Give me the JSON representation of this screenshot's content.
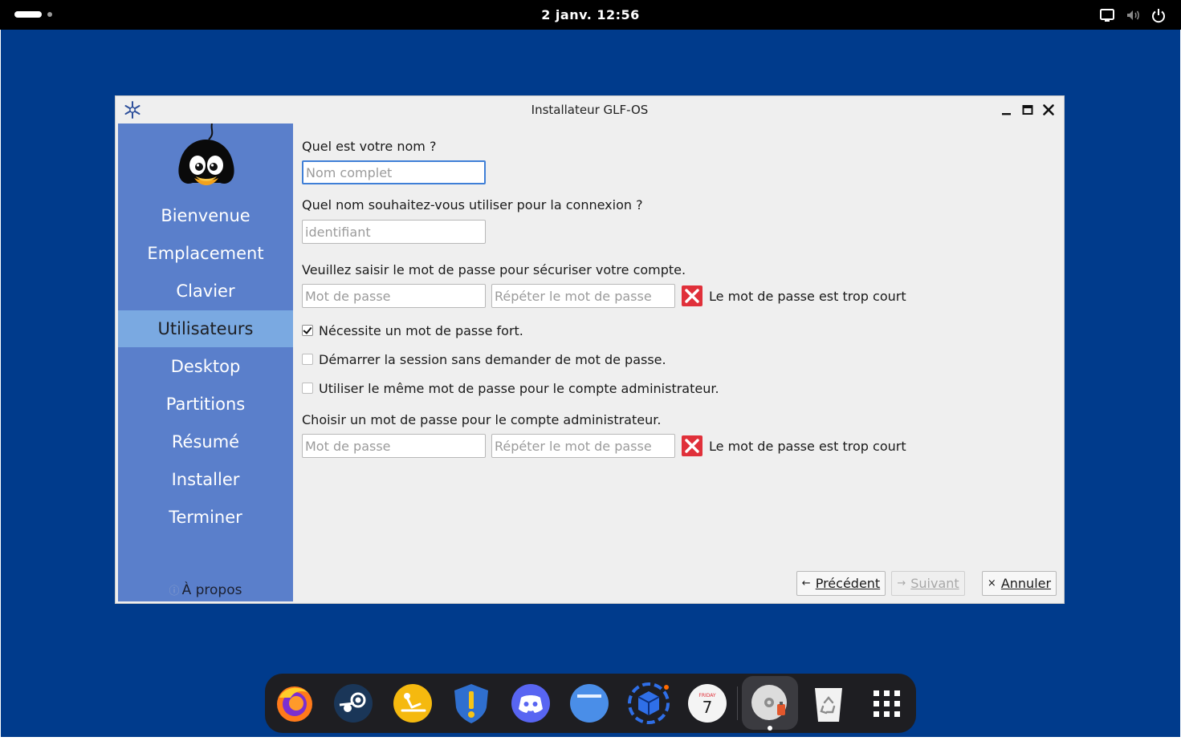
{
  "topbar": {
    "clock": "2 janv. 12:56",
    "icons": [
      "display-icon",
      "volume-muted-icon",
      "power-icon"
    ]
  },
  "window": {
    "title": "Installateur GLF-OS",
    "controls": [
      "minimize-icon",
      "maximize-icon",
      "close-icon"
    ]
  },
  "sidebar": {
    "steps": [
      {
        "label": "Bienvenue",
        "active": false
      },
      {
        "label": "Emplacement",
        "active": false
      },
      {
        "label": "Clavier",
        "active": false
      },
      {
        "label": "Utilisateurs",
        "active": true
      },
      {
        "label": "Desktop",
        "active": false
      },
      {
        "label": "Partitions",
        "active": false
      },
      {
        "label": "Résumé",
        "active": false
      },
      {
        "label": "Installer",
        "active": false
      },
      {
        "label": "Terminer",
        "active": false
      }
    ],
    "about_label": "À propos",
    "accent_color": "#5a7fcb",
    "active_color": "#7aa9e1"
  },
  "form": {
    "name_question": "Quel est votre nom ?",
    "name_placeholder": "Nom complet",
    "login_question": "Quel nom souhaitez-vous utiliser pour la connexion ?",
    "login_placeholder": "identifiant",
    "password_question": "Veuillez saisir le mot de passe pour sécuriser votre compte.",
    "password_placeholder": "Mot de passe",
    "repeat_placeholder": "Répéter le mot de passe",
    "password_error": "Le mot de passe est trop court",
    "checkbox_strong": "Nécessite un mot de passe fort.",
    "checkbox_strong_checked": true,
    "checkbox_autologin": "Démarrer la session sans demander de mot de passe.",
    "checkbox_autologin_checked": false,
    "checkbox_same_admin": "Utiliser le même mot de passe pour le compte administrateur.",
    "checkbox_same_admin_checked": false,
    "admin_question": "Choisir un mot de passe pour le compte administrateur.",
    "admin_password_placeholder": "Mot de passe",
    "admin_repeat_placeholder": "Répéter le mot de passe",
    "admin_error": "Le mot de passe est trop court",
    "error_color": "#e0303a"
  },
  "buttons": {
    "previous": "Précédent",
    "next": "Suivant",
    "cancel": "Annuler"
  },
  "dock": {
    "apps": [
      "firefox-icon",
      "steam-icon",
      "lutris-icon",
      "heroic-icon",
      "discord-icon",
      "files-icon",
      "application-store-icon",
      "calendar-icon",
      "installer-disc-icon",
      "trash-icon",
      "app-grid-icon"
    ],
    "calendar_day": "FRIDAY",
    "calendar_date": "7"
  },
  "desktop_color": "#003b8c"
}
